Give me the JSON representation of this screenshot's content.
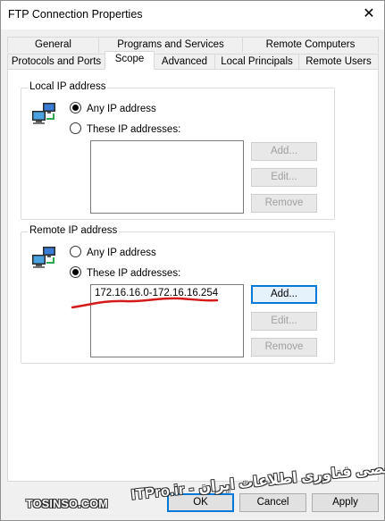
{
  "window": {
    "title": "FTP Connection Properties",
    "close_glyph": "✕"
  },
  "tabs_row1": [
    "General",
    "Programs and Services",
    "Remote Computers"
  ],
  "tabs_row2": [
    "Protocols and Ports",
    "Scope",
    "Advanced",
    "Local Principals",
    "Remote Users"
  ],
  "active_tab": "Scope",
  "local_group": {
    "label": "Local IP address",
    "any_label": "Any IP address",
    "these_label": "These IP addresses:",
    "selected": "any",
    "addresses": [],
    "buttons": {
      "add": "Add...",
      "edit": "Edit...",
      "remove": "Remove"
    }
  },
  "remote_group": {
    "label": "Remote IP address",
    "any_label": "Any IP address",
    "these_label": "These IP addresses:",
    "selected": "these",
    "addresses": [
      "172.16.16.0-172.16.16.254"
    ],
    "buttons": {
      "add": "Add...",
      "edit": "Edit...",
      "remove": "Remove"
    }
  },
  "dialog_buttons": {
    "ok": "OK",
    "cancel": "Cancel",
    "apply": "Apply"
  },
  "icons": {
    "local": "network-computers-icon",
    "remote": "network-computers-icon"
  },
  "watermark": {
    "left": "TOSINSO.COM",
    "right": "ITPro.ir - انجمن تخصصی فناوری اطلاعات ایران"
  },
  "colors": {
    "accent": "#0078d7",
    "annotation": "#d41a1a"
  }
}
